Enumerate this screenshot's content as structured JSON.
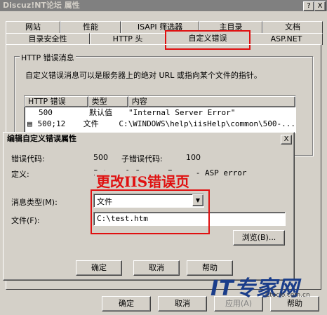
{
  "main_window": {
    "title": "Discuz!NT论坛 属性",
    "help_button": "?",
    "close_button": "X",
    "tabs_row1": [
      "网站",
      "性能",
      "ISAPI 筛选器",
      "主目录",
      "文档"
    ],
    "tabs_row2": [
      "目录安全性",
      "HTTP 头",
      "自定义错误",
      "ASP.NET"
    ],
    "group_label": "HTTP 错误消息",
    "description": "自定义错误消息可以是服务器上的绝对 URL 或指向某个文件的指针。",
    "list_headers": [
      "HTTP 错误",
      "类型",
      "内容"
    ],
    "list_rows": [
      {
        "code": "500",
        "type": "默认值",
        "content": "\"Internal Server Error\""
      },
      {
        "code": "500;12",
        "type": "文件",
        "content": "C:\\WINDOWS\\help\\iisHelp\\common\\500-..."
      }
    ],
    "buttons": {
      "ok": "确定",
      "cancel": "取消",
      "apply": "应用(A)",
      "help": "帮助"
    }
  },
  "dialog": {
    "title": "编辑自定义错误属性",
    "close_button": "X",
    "error_code_label": "错误代码:",
    "error_code_value": "500",
    "sub_error_label": "子错误代码:",
    "sub_error_value": "100",
    "definition_label": "定义:",
    "definition_value": "Internal Server Error - ASP error",
    "message_type_label": "消息类型(M):",
    "message_type_value": "文件",
    "file_label": "文件(F):",
    "file_value": "C:\\test.htm",
    "browse_button": "浏览(B)...",
    "ok_button": "确定",
    "cancel_button": "取消",
    "help_button": "帮助"
  },
  "annotation": {
    "text": "更改IIS错误页",
    "color": "#e01010"
  },
  "watermark": {
    "brand": "IT专家网",
    "site": "Ctocio.com.cn"
  }
}
